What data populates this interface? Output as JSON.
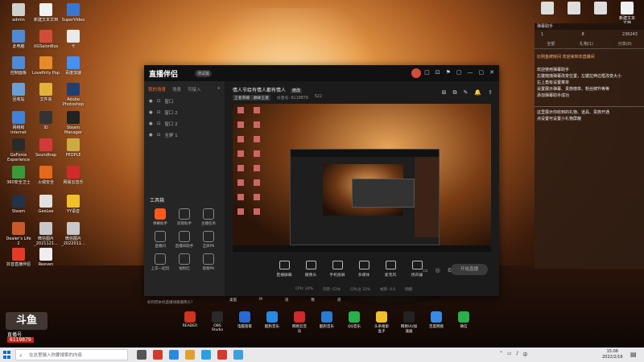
{
  "desktop": {
    "icons_left": [
      {
        "label": "admin",
        "color": "#cfcfcf"
      },
      {
        "label": "新建文本文档",
        "color": "#f1f1f1"
      },
      {
        "label": "SuperVideo",
        "color": "#3a76d0"
      },
      {
        "label": "此电脑",
        "color": "#4e8ad6"
      },
      {
        "label": "UGSalonBox",
        "color": "#d24c3a"
      },
      {
        "label": "卡",
        "color": "#e9e9e9"
      },
      {
        "label": "控制面板",
        "color": "#4e8ad6"
      },
      {
        "label": "Lovefirity Pop",
        "color": "#e58b2a"
      },
      {
        "label": "百度加速",
        "color": "#4690f0"
      },
      {
        "label": "回收站",
        "color": "#6aa0d8"
      },
      {
        "label": "文件夹",
        "color": "#e2b23a"
      },
      {
        "label": "Adobe Photoshop",
        "color": "#1f3f70"
      },
      {
        "label": "网络和Internet",
        "color": "#3f82d6"
      },
      {
        "label": "ID",
        "color": "#333333"
      },
      {
        "label": "Steam Manager",
        "color": "#222222"
      },
      {
        "label": "GeForce Experience",
        "color": "#2a2a2a"
      },
      {
        "label": "Soundtrap",
        "color": "#d23a3a"
      },
      {
        "label": "PEOPLE",
        "color": "#ccaa44"
      },
      {
        "label": "360安全卫士",
        "color": "#3a9a3a"
      },
      {
        "label": "火绒安全",
        "color": "#e26a1a"
      },
      {
        "label": "网易云音乐",
        "color": "#d02a2a"
      },
      {
        "label": "Steam",
        "color": "#22324a"
      },
      {
        "label": "GeeLee",
        "color": "#e0e0e0"
      },
      {
        "label": "YY语音",
        "color": "#f0c02a"
      },
      {
        "label": "Dealer's Life 2",
        "color": "#c85a2a"
      },
      {
        "label": "微信图片_2021121...",
        "color": "#c8c8c8"
      },
      {
        "label": "微信图片_2022011...",
        "color": "#c8c8c8"
      },
      {
        "label": "抖音直播伴侣",
        "color": "#e53a2a"
      },
      {
        "label": "Reeven",
        "color": "#eeeeee"
      }
    ],
    "top_right_icons": [
      {
        "label": "",
        "color": "#dddddd"
      },
      {
        "label": "",
        "color": "#dddddd"
      },
      {
        "label": "",
        "color": "#dddddd"
      },
      {
        "label": "新建文本文档",
        "color": "#f1f1f1"
      }
    ],
    "dock": [
      {
        "label": "READER",
        "color": "#d0331f"
      },
      {
        "label": "OBS Studio",
        "color": "#2a2a2a"
      },
      {
        "label": "电脑管家",
        "color": "#2a6ad2"
      },
      {
        "label": "酷狗音乐",
        "color": "#2a8ae2"
      },
      {
        "label": "网易云音乐",
        "color": "#d02a2a"
      },
      {
        "label": "酷狗音乐",
        "color": "#2a7ad2"
      },
      {
        "label": "QQ音乐",
        "color": "#2ab04a"
      },
      {
        "label": "头条搜索盒子",
        "color": "#f0c02a"
      },
      {
        "label": "网易UU加速器",
        "color": "#222222"
      },
      {
        "label": "百度网盘",
        "color": "#3a8ae2"
      },
      {
        "label": "微信",
        "color": "#2ab04a"
      }
    ],
    "dock_row_labels": [
      "桌面",
      "M",
      "道",
      "数",
      "道"
    ]
  },
  "app": {
    "name": "直播伴侣",
    "beta": "测试版",
    "window_controls": [
      "□",
      "⊡",
      "⚑",
      "▢",
      "—",
      "▢",
      "✕"
    ],
    "left_tabs": [
      "我的场景",
      "场景",
      "可接入"
    ],
    "left_add": "+",
    "scenes": [
      {
        "label": "窗口"
      },
      {
        "label": "窗口 2"
      },
      {
        "label": "窗口 2"
      },
      {
        "label": "全屏 1"
      }
    ],
    "tools_title": "工具箱",
    "tools": [
      {
        "label": "弹幕助手",
        "hot": true
      },
      {
        "label": "房管助手",
        "hot": false
      },
      {
        "label": "主播任务",
        "hot": false
      },
      {
        "label": "直播间",
        "hot": false
      },
      {
        "label": "直播间助手",
        "hot": false
      },
      {
        "label": "全屏PK",
        "hot": false
      },
      {
        "label": "上车一起玩",
        "hot": false
      },
      {
        "label": "福利红",
        "hot": false
      },
      {
        "label": "观察PK",
        "hot": false
      }
    ],
    "hint": "如何把本机直播线路摄像头?",
    "room_title": "情人节给有情人都有情人",
    "room_tag": "修改",
    "room_meta": [
      "王者荣耀 · 巅峰王者",
      "抖音号: 6119879",
      "522"
    ],
    "room_actions": [
      "⊞",
      "⧉",
      "✎",
      "🔔",
      "⇪"
    ],
    "controls": [
      {
        "label": "直播屏幕"
      },
      {
        "label": "摄像头"
      },
      {
        "label": "手机投屏"
      },
      {
        "label": "多媒体"
      },
      {
        "label": "麦克风"
      },
      {
        "label": "扬声器"
      }
    ],
    "ctrl_right": [
      "▭",
      "◎",
      "⚙"
    ],
    "go_live": "开始直播",
    "status": [
      "CPU: 24%",
      "内存: 53%",
      "CPU占 33%",
      "帧率: 0.0",
      "网络"
    ]
  },
  "chat": {
    "header": "弹幕助手",
    "stats": [
      "1",
      "8",
      "236243"
    ],
    "tabs": [
      "全部",
      "礼物(1)",
      "分享(0)"
    ],
    "first": "比例金牌房间 欢迎来到本直播间",
    "msg1": "欢迎使用弹幕助手\n左键拖拽弹幕改变位置，左键拉伸边框改变大小\n右上角有设置菜单\n设置展示弹幕、贵族榜单、粉丝牌升等等\n添加弹幕助手成功",
    "msg2": "这里展示你收到的礼物、道具、贵族开通\n点设置可设置小礼物屏蔽"
  },
  "watermark": {
    "logo": "斗鱼",
    "label": "直播号",
    "number": "6119879"
  },
  "taskbar": {
    "search_placeholder": "在这里输入你要搜索的内容",
    "time": "15:06",
    "date": "2022/2/16",
    "apps_colors": [
      "#555555",
      "#d23a2a",
      "#2a8ae2",
      "#e2a02a",
      "#2aa0e2",
      "#d23a2a",
      "#3aa0e2"
    ]
  }
}
